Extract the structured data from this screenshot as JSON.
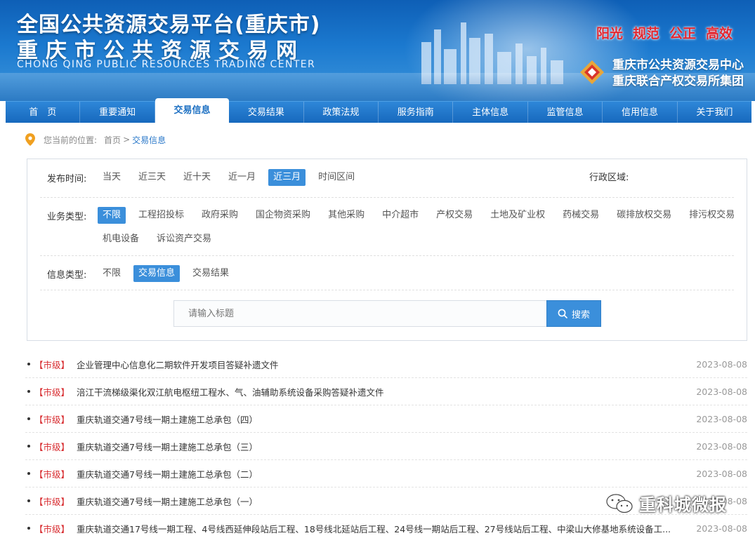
{
  "banner": {
    "title_main": "全国公共资源交易平台(重庆市)",
    "title_sub": "重庆市公共资源交易网",
    "title_en": "CHONG QING PUBLIC RESOURCES TRADING CENTER",
    "slogans": [
      "阳光",
      "规范",
      "公正",
      "高效"
    ],
    "org_names": [
      "重庆市公共资源交易中心",
      "重庆联合产权交易所集团"
    ]
  },
  "nav": {
    "items": [
      "首　页",
      "重要通知",
      "交易信息",
      "交易结果",
      "政策法规",
      "服务指南",
      "主体信息",
      "监管信息",
      "信用信息",
      "关于我们"
    ],
    "active": "交易信息"
  },
  "breadcrumb": {
    "prefix": "您当前的位置:",
    "home": "首页",
    "separator": ">",
    "current": "交易信息"
  },
  "filters": {
    "time": {
      "label": "发布时间:",
      "options": [
        "当天",
        "近三天",
        "近十天",
        "近一月",
        "近三月",
        "时间区间"
      ],
      "selected": "近三月"
    },
    "region_label": "行政区域:",
    "business": {
      "label": "业务类型:",
      "options": [
        "不限",
        "工程招投标",
        "政府采购",
        "国企物资采购",
        "其他采购",
        "中介超市",
        "产权交易",
        "土地及矿业权",
        "药械交易",
        "碳排放权交易",
        "排污权交易",
        "机电设备",
        "诉讼资产交易"
      ],
      "selected": "不限"
    },
    "info": {
      "label": "信息类型:",
      "options": [
        "不限",
        "交易信息",
        "交易结果"
      ],
      "selected": "交易信息"
    }
  },
  "search": {
    "placeholder": "请输入标题",
    "button": "搜索"
  },
  "list": [
    {
      "level": "【市级】",
      "title": "企业管理中心信息化二期软件开发项目答疑补遗文件",
      "date": "2023-08-08"
    },
    {
      "level": "【市级】",
      "title": "涪江干流梯级渠化双江航电枢纽工程水、气、油辅助系统设备采购答疑补遗文件",
      "date": "2023-08-08"
    },
    {
      "level": "【市级】",
      "title": "重庆轨道交通7号线一期土建施工总承包（四）",
      "date": "2023-08-08"
    },
    {
      "level": "【市级】",
      "title": "重庆轨道交通7号线一期土建施工总承包（三）",
      "date": "2023-08-08"
    },
    {
      "level": "【市级】",
      "title": "重庆轨道交通7号线一期土建施工总承包（二）",
      "date": "2023-08-08"
    },
    {
      "level": "【市级】",
      "title": "重庆轨道交通7号线一期土建施工总承包（一）",
      "date": "2023-08-08"
    },
    {
      "level": "【市级】",
      "title": "重庆轨道交通17号线一期工程、4号线西延伸段站后工程、18号线北延站后工程、24号线一期站后工程、27号线站后工程、中梁山大修基地系统设备工...",
      "date": "2023-08-08"
    }
  ],
  "watermark": "重科城微报",
  "colors": {
    "nav_bg": "#1b6fc2",
    "accent": "#3b8fdb",
    "level_red": "#d7292d",
    "slogan_red": "#e3262f"
  }
}
